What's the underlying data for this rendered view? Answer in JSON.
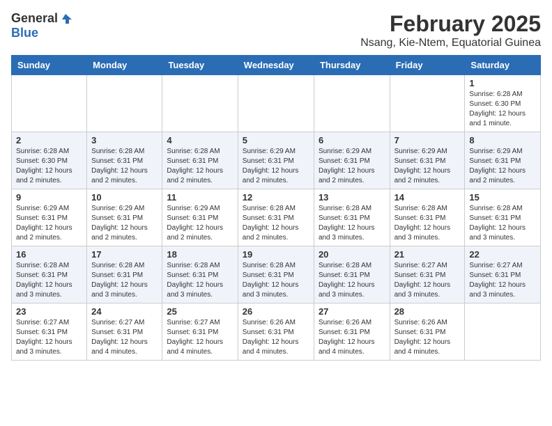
{
  "logo": {
    "general": "General",
    "blue": "Blue"
  },
  "header": {
    "title": "February 2025",
    "subtitle": "Nsang, Kie-Ntem, Equatorial Guinea"
  },
  "days_of_week": [
    "Sunday",
    "Monday",
    "Tuesday",
    "Wednesday",
    "Thursday",
    "Friday",
    "Saturday"
  ],
  "weeks": [
    [
      {
        "day": "",
        "info": ""
      },
      {
        "day": "",
        "info": ""
      },
      {
        "day": "",
        "info": ""
      },
      {
        "day": "",
        "info": ""
      },
      {
        "day": "",
        "info": ""
      },
      {
        "day": "",
        "info": ""
      },
      {
        "day": "1",
        "info": "Sunrise: 6:28 AM\nSunset: 6:30 PM\nDaylight: 12 hours and 1 minute."
      }
    ],
    [
      {
        "day": "2",
        "info": "Sunrise: 6:28 AM\nSunset: 6:30 PM\nDaylight: 12 hours and 2 minutes."
      },
      {
        "day": "3",
        "info": "Sunrise: 6:28 AM\nSunset: 6:31 PM\nDaylight: 12 hours and 2 minutes."
      },
      {
        "day": "4",
        "info": "Sunrise: 6:28 AM\nSunset: 6:31 PM\nDaylight: 12 hours and 2 minutes."
      },
      {
        "day": "5",
        "info": "Sunrise: 6:29 AM\nSunset: 6:31 PM\nDaylight: 12 hours and 2 minutes."
      },
      {
        "day": "6",
        "info": "Sunrise: 6:29 AM\nSunset: 6:31 PM\nDaylight: 12 hours and 2 minutes."
      },
      {
        "day": "7",
        "info": "Sunrise: 6:29 AM\nSunset: 6:31 PM\nDaylight: 12 hours and 2 minutes."
      },
      {
        "day": "8",
        "info": "Sunrise: 6:29 AM\nSunset: 6:31 PM\nDaylight: 12 hours and 2 minutes."
      }
    ],
    [
      {
        "day": "9",
        "info": "Sunrise: 6:29 AM\nSunset: 6:31 PM\nDaylight: 12 hours and 2 minutes."
      },
      {
        "day": "10",
        "info": "Sunrise: 6:29 AM\nSunset: 6:31 PM\nDaylight: 12 hours and 2 minutes."
      },
      {
        "day": "11",
        "info": "Sunrise: 6:29 AM\nSunset: 6:31 PM\nDaylight: 12 hours and 2 minutes."
      },
      {
        "day": "12",
        "info": "Sunrise: 6:28 AM\nSunset: 6:31 PM\nDaylight: 12 hours and 2 minutes."
      },
      {
        "day": "13",
        "info": "Sunrise: 6:28 AM\nSunset: 6:31 PM\nDaylight: 12 hours and 3 minutes."
      },
      {
        "day": "14",
        "info": "Sunrise: 6:28 AM\nSunset: 6:31 PM\nDaylight: 12 hours and 3 minutes."
      },
      {
        "day": "15",
        "info": "Sunrise: 6:28 AM\nSunset: 6:31 PM\nDaylight: 12 hours and 3 minutes."
      }
    ],
    [
      {
        "day": "16",
        "info": "Sunrise: 6:28 AM\nSunset: 6:31 PM\nDaylight: 12 hours and 3 minutes."
      },
      {
        "day": "17",
        "info": "Sunrise: 6:28 AM\nSunset: 6:31 PM\nDaylight: 12 hours and 3 minutes."
      },
      {
        "day": "18",
        "info": "Sunrise: 6:28 AM\nSunset: 6:31 PM\nDaylight: 12 hours and 3 minutes."
      },
      {
        "day": "19",
        "info": "Sunrise: 6:28 AM\nSunset: 6:31 PM\nDaylight: 12 hours and 3 minutes."
      },
      {
        "day": "20",
        "info": "Sunrise: 6:28 AM\nSunset: 6:31 PM\nDaylight: 12 hours and 3 minutes."
      },
      {
        "day": "21",
        "info": "Sunrise: 6:27 AM\nSunset: 6:31 PM\nDaylight: 12 hours and 3 minutes."
      },
      {
        "day": "22",
        "info": "Sunrise: 6:27 AM\nSunset: 6:31 PM\nDaylight: 12 hours and 3 minutes."
      }
    ],
    [
      {
        "day": "23",
        "info": "Sunrise: 6:27 AM\nSunset: 6:31 PM\nDaylight: 12 hours and 3 minutes."
      },
      {
        "day": "24",
        "info": "Sunrise: 6:27 AM\nSunset: 6:31 PM\nDaylight: 12 hours and 4 minutes."
      },
      {
        "day": "25",
        "info": "Sunrise: 6:27 AM\nSunset: 6:31 PM\nDaylight: 12 hours and 4 minutes."
      },
      {
        "day": "26",
        "info": "Sunrise: 6:26 AM\nSunset: 6:31 PM\nDaylight: 12 hours and 4 minutes."
      },
      {
        "day": "27",
        "info": "Sunrise: 6:26 AM\nSunset: 6:31 PM\nDaylight: 12 hours and 4 minutes."
      },
      {
        "day": "28",
        "info": "Sunrise: 6:26 AM\nSunset: 6:31 PM\nDaylight: 12 hours and 4 minutes."
      },
      {
        "day": "",
        "info": ""
      }
    ]
  ]
}
